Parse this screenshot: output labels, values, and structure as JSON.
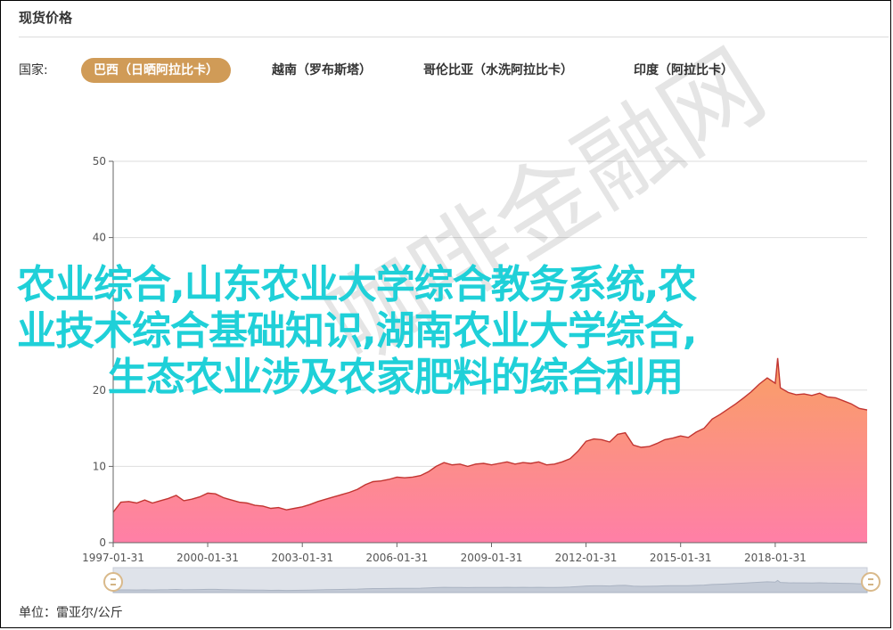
{
  "panel": {
    "title": "现货价格"
  },
  "filter": {
    "label": "国家:",
    "tabs": [
      {
        "label": "巴西（日晒阿拉比卡）",
        "active": true
      },
      {
        "label": "越南（罗布斯塔）",
        "active": false
      },
      {
        "label": "哥伦比亚（水洗阿拉比卡）",
        "active": false
      },
      {
        "label": "印度（阿拉比卡）",
        "active": false
      }
    ]
  },
  "unit_label": "单位：雷亚尔/公斤",
  "overlay": {
    "line1": "农业综合,山东农业大学综合教务系统,农",
    "line2": "业技术综合基础知识,湖南农业大学综合,",
    "line3": "生态农业涉及农家肥料的综合利用"
  },
  "watermark": "咖啡金融网",
  "colors": {
    "accent": "#d09b57",
    "line": "#c23531",
    "area_top": "#f9a064",
    "area_bottom": "#ff7fa7",
    "overlay_text": "#1fd0d8"
  },
  "chart_data": {
    "type": "area",
    "title": "",
    "xlabel": "",
    "ylabel": "",
    "ylim": [
      0,
      50
    ],
    "y_ticks": [
      0,
      10,
      20,
      40,
      50
    ],
    "x_ticks": [
      "1997-01-31",
      "2000-01-31",
      "2003-01-31",
      "2006-01-31",
      "2009-01-31",
      "2012-01-31",
      "2015-01-31",
      "2018-01-31"
    ],
    "xlim": [
      "1997-01-31",
      "2020-12-31"
    ],
    "grid": true,
    "series": [
      {
        "points": [
          [
            "1997-01-31",
            4.0
          ],
          [
            "1997-04-30",
            5.3
          ],
          [
            "1997-07-31",
            5.4
          ],
          [
            "1997-10-31",
            5.2
          ],
          [
            "1998-01-31",
            5.6
          ],
          [
            "1998-04-30",
            5.2
          ],
          [
            "1998-07-31",
            5.5
          ],
          [
            "1998-10-31",
            5.8
          ],
          [
            "1999-01-31",
            6.2
          ],
          [
            "1999-04-30",
            5.5
          ],
          [
            "1999-07-31",
            5.7
          ],
          [
            "1999-10-31",
            6.0
          ],
          [
            "2000-01-31",
            6.5
          ],
          [
            "2000-04-30",
            6.4
          ],
          [
            "2000-07-31",
            5.9
          ],
          [
            "2000-10-31",
            5.6
          ],
          [
            "2001-01-31",
            5.3
          ],
          [
            "2001-04-30",
            5.2
          ],
          [
            "2001-07-31",
            4.9
          ],
          [
            "2001-10-31",
            4.8
          ],
          [
            "2002-01-31",
            4.5
          ],
          [
            "2002-04-30",
            4.6
          ],
          [
            "2002-07-31",
            4.3
          ],
          [
            "2002-10-31",
            4.5
          ],
          [
            "2003-01-31",
            4.7
          ],
          [
            "2003-04-30",
            5.0
          ],
          [
            "2003-07-31",
            5.4
          ],
          [
            "2003-10-31",
            5.7
          ],
          [
            "2004-01-31",
            6.0
          ],
          [
            "2004-04-30",
            6.3
          ],
          [
            "2004-07-31",
            6.6
          ],
          [
            "2004-10-31",
            7.0
          ],
          [
            "2005-01-31",
            7.6
          ],
          [
            "2005-04-30",
            8.0
          ],
          [
            "2005-07-31",
            8.1
          ],
          [
            "2005-10-31",
            8.3
          ],
          [
            "2006-01-31",
            8.6
          ],
          [
            "2006-04-30",
            8.5
          ],
          [
            "2006-07-31",
            8.6
          ],
          [
            "2006-10-31",
            8.8
          ],
          [
            "2007-01-31",
            9.3
          ],
          [
            "2007-04-30",
            10.0
          ],
          [
            "2007-07-31",
            10.5
          ],
          [
            "2007-10-31",
            10.2
          ],
          [
            "2008-01-31",
            10.3
          ],
          [
            "2008-04-30",
            10.0
          ],
          [
            "2008-07-31",
            10.3
          ],
          [
            "2008-10-31",
            10.4
          ],
          [
            "2009-01-31",
            10.2
          ],
          [
            "2009-04-30",
            10.4
          ],
          [
            "2009-07-31",
            10.6
          ],
          [
            "2009-10-31",
            10.3
          ],
          [
            "2010-01-31",
            10.5
          ],
          [
            "2010-04-30",
            10.4
          ],
          [
            "2010-07-31",
            10.6
          ],
          [
            "2010-10-31",
            10.2
          ],
          [
            "2011-01-31",
            10.3
          ],
          [
            "2011-04-30",
            10.6
          ],
          [
            "2011-07-31",
            11.0
          ],
          [
            "2011-10-31",
            12.0
          ],
          [
            "2012-01-31",
            13.3
          ],
          [
            "2012-04-30",
            13.6
          ],
          [
            "2012-07-31",
            13.5
          ],
          [
            "2012-10-31",
            13.2
          ],
          [
            "2013-01-31",
            14.2
          ],
          [
            "2013-04-30",
            14.4
          ],
          [
            "2013-07-31",
            12.8
          ],
          [
            "2013-10-31",
            12.5
          ],
          [
            "2014-01-31",
            12.6
          ],
          [
            "2014-04-30",
            13.0
          ],
          [
            "2014-07-31",
            13.5
          ],
          [
            "2014-10-31",
            13.7
          ],
          [
            "2015-01-31",
            14.0
          ],
          [
            "2015-04-30",
            13.8
          ],
          [
            "2015-07-31",
            14.5
          ],
          [
            "2015-10-31",
            15.0
          ],
          [
            "2016-01-31",
            16.2
          ],
          [
            "2016-04-30",
            16.8
          ],
          [
            "2016-07-31",
            17.5
          ],
          [
            "2016-10-31",
            18.2
          ],
          [
            "2017-01-31",
            19.0
          ],
          [
            "2017-04-30",
            19.8
          ],
          [
            "2017-07-31",
            20.8
          ],
          [
            "2017-10-31",
            21.6
          ],
          [
            "2018-01-31",
            20.9
          ],
          [
            "2018-02-28",
            24.2
          ],
          [
            "2018-03-31",
            20.3
          ],
          [
            "2018-06-30",
            19.7
          ],
          [
            "2018-09-30",
            19.4
          ],
          [
            "2018-12-31",
            19.5
          ],
          [
            "2019-03-31",
            19.3
          ],
          [
            "2019-06-30",
            19.6
          ],
          [
            "2019-09-30",
            19.1
          ],
          [
            "2019-12-31",
            19.0
          ],
          [
            "2020-03-31",
            18.6
          ],
          [
            "2020-06-30",
            18.2
          ],
          [
            "2020-09-30",
            17.6
          ],
          [
            "2020-12-31",
            17.4
          ]
        ]
      }
    ]
  }
}
